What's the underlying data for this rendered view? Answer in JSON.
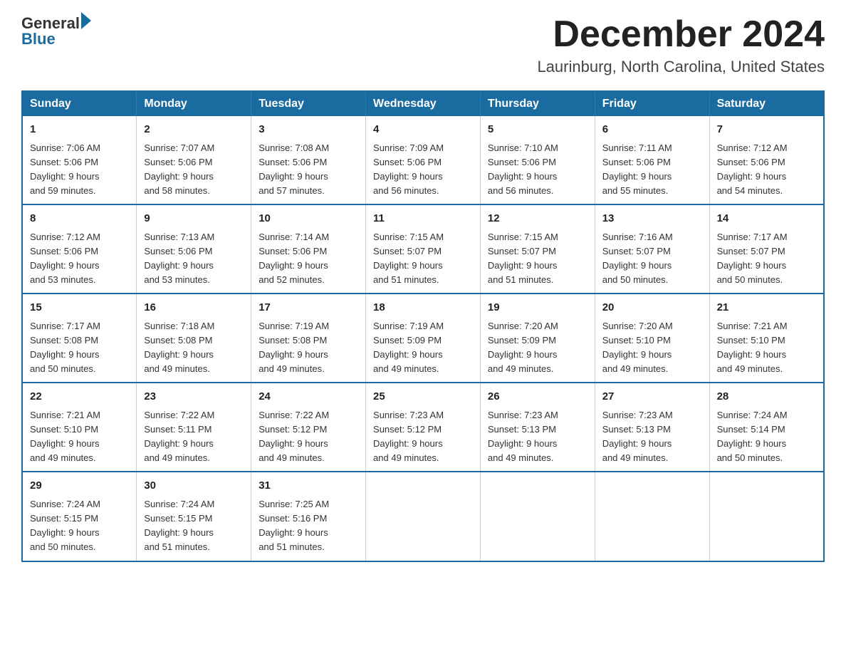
{
  "logo": {
    "text_general": "General",
    "text_blue": "Blue",
    "arrow_char": "▶"
  },
  "title": {
    "month_year": "December 2024",
    "location": "Laurinburg, North Carolina, United States"
  },
  "weekdays": [
    "Sunday",
    "Monday",
    "Tuesday",
    "Wednesday",
    "Thursday",
    "Friday",
    "Saturday"
  ],
  "weeks": [
    [
      {
        "day": "1",
        "sunrise": "7:06 AM",
        "sunset": "5:06 PM",
        "daylight": "9 hours and 59 minutes."
      },
      {
        "day": "2",
        "sunrise": "7:07 AM",
        "sunset": "5:06 PM",
        "daylight": "9 hours and 58 minutes."
      },
      {
        "day": "3",
        "sunrise": "7:08 AM",
        "sunset": "5:06 PM",
        "daylight": "9 hours and 57 minutes."
      },
      {
        "day": "4",
        "sunrise": "7:09 AM",
        "sunset": "5:06 PM",
        "daylight": "9 hours and 56 minutes."
      },
      {
        "day": "5",
        "sunrise": "7:10 AM",
        "sunset": "5:06 PM",
        "daylight": "9 hours and 56 minutes."
      },
      {
        "day": "6",
        "sunrise": "7:11 AM",
        "sunset": "5:06 PM",
        "daylight": "9 hours and 55 minutes."
      },
      {
        "day": "7",
        "sunrise": "7:12 AM",
        "sunset": "5:06 PM",
        "daylight": "9 hours and 54 minutes."
      }
    ],
    [
      {
        "day": "8",
        "sunrise": "7:12 AM",
        "sunset": "5:06 PM",
        "daylight": "9 hours and 53 minutes."
      },
      {
        "day": "9",
        "sunrise": "7:13 AM",
        "sunset": "5:06 PM",
        "daylight": "9 hours and 53 minutes."
      },
      {
        "day": "10",
        "sunrise": "7:14 AM",
        "sunset": "5:06 PM",
        "daylight": "9 hours and 52 minutes."
      },
      {
        "day": "11",
        "sunrise": "7:15 AM",
        "sunset": "5:07 PM",
        "daylight": "9 hours and 51 minutes."
      },
      {
        "day": "12",
        "sunrise": "7:15 AM",
        "sunset": "5:07 PM",
        "daylight": "9 hours and 51 minutes."
      },
      {
        "day": "13",
        "sunrise": "7:16 AM",
        "sunset": "5:07 PM",
        "daylight": "9 hours and 50 minutes."
      },
      {
        "day": "14",
        "sunrise": "7:17 AM",
        "sunset": "5:07 PM",
        "daylight": "9 hours and 50 minutes."
      }
    ],
    [
      {
        "day": "15",
        "sunrise": "7:17 AM",
        "sunset": "5:08 PM",
        "daylight": "9 hours and 50 minutes."
      },
      {
        "day": "16",
        "sunrise": "7:18 AM",
        "sunset": "5:08 PM",
        "daylight": "9 hours and 49 minutes."
      },
      {
        "day": "17",
        "sunrise": "7:19 AM",
        "sunset": "5:08 PM",
        "daylight": "9 hours and 49 minutes."
      },
      {
        "day": "18",
        "sunrise": "7:19 AM",
        "sunset": "5:09 PM",
        "daylight": "9 hours and 49 minutes."
      },
      {
        "day": "19",
        "sunrise": "7:20 AM",
        "sunset": "5:09 PM",
        "daylight": "9 hours and 49 minutes."
      },
      {
        "day": "20",
        "sunrise": "7:20 AM",
        "sunset": "5:10 PM",
        "daylight": "9 hours and 49 minutes."
      },
      {
        "day": "21",
        "sunrise": "7:21 AM",
        "sunset": "5:10 PM",
        "daylight": "9 hours and 49 minutes."
      }
    ],
    [
      {
        "day": "22",
        "sunrise": "7:21 AM",
        "sunset": "5:10 PM",
        "daylight": "9 hours and 49 minutes."
      },
      {
        "day": "23",
        "sunrise": "7:22 AM",
        "sunset": "5:11 PM",
        "daylight": "9 hours and 49 minutes."
      },
      {
        "day": "24",
        "sunrise": "7:22 AM",
        "sunset": "5:12 PM",
        "daylight": "9 hours and 49 minutes."
      },
      {
        "day": "25",
        "sunrise": "7:23 AM",
        "sunset": "5:12 PM",
        "daylight": "9 hours and 49 minutes."
      },
      {
        "day": "26",
        "sunrise": "7:23 AM",
        "sunset": "5:13 PM",
        "daylight": "9 hours and 49 minutes."
      },
      {
        "day": "27",
        "sunrise": "7:23 AM",
        "sunset": "5:13 PM",
        "daylight": "9 hours and 49 minutes."
      },
      {
        "day": "28",
        "sunrise": "7:24 AM",
        "sunset": "5:14 PM",
        "daylight": "9 hours and 50 minutes."
      }
    ],
    [
      {
        "day": "29",
        "sunrise": "7:24 AM",
        "sunset": "5:15 PM",
        "daylight": "9 hours and 50 minutes."
      },
      {
        "day": "30",
        "sunrise": "7:24 AM",
        "sunset": "5:15 PM",
        "daylight": "9 hours and 51 minutes."
      },
      {
        "day": "31",
        "sunrise": "7:25 AM",
        "sunset": "5:16 PM",
        "daylight": "9 hours and 51 minutes."
      },
      null,
      null,
      null,
      null
    ]
  ],
  "labels": {
    "sunrise": "Sunrise:",
    "sunset": "Sunset:",
    "daylight": "Daylight:"
  }
}
